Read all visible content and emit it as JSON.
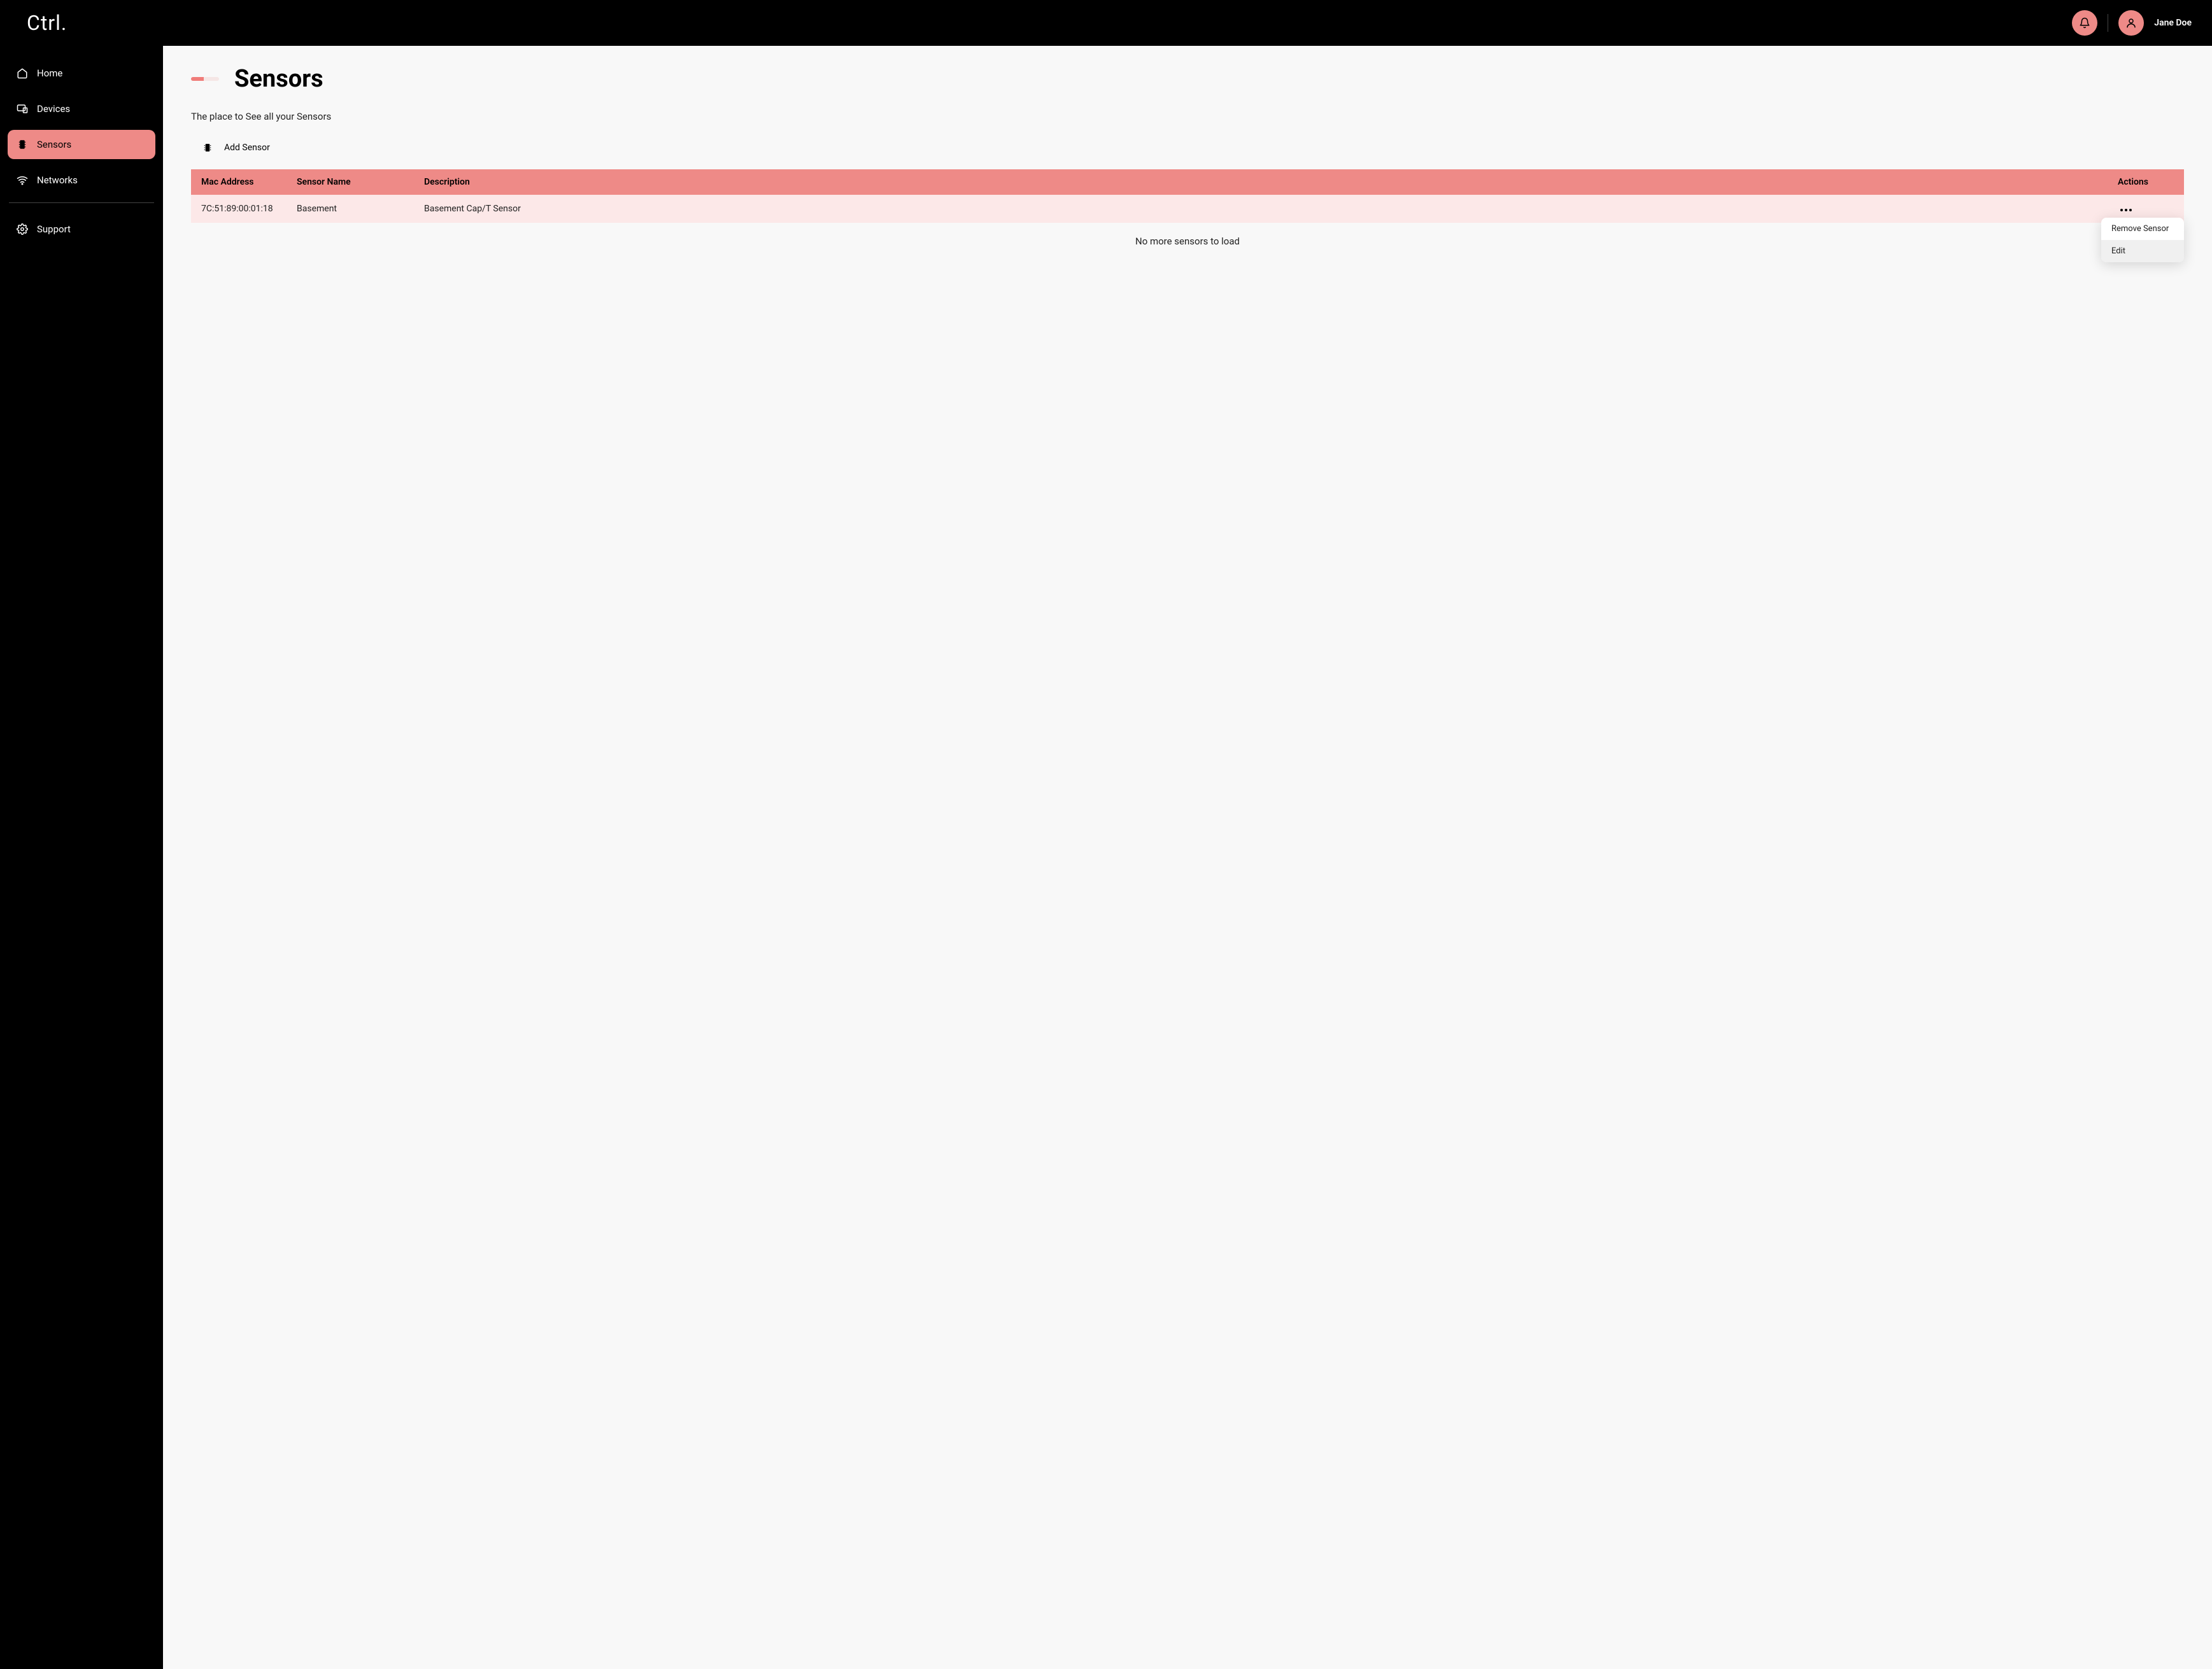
{
  "brand": "Ctrl.",
  "user": {
    "name": "Jane Doe"
  },
  "sidebar": {
    "items": [
      {
        "label": "Home"
      },
      {
        "label": "Devices"
      },
      {
        "label": "Sensors"
      },
      {
        "label": "Networks"
      },
      {
        "label": "Support"
      }
    ]
  },
  "page": {
    "title": "Sensors",
    "subtitle": "The place to See all your Sensors",
    "add_label": "Add Sensor",
    "no_more": "No more sensors to load"
  },
  "table": {
    "headers": {
      "mac": "Mac Address",
      "name": "Sensor Name",
      "description": "Description",
      "actions": "Actions"
    },
    "rows": [
      {
        "mac": "7C:51:89:00:01:18",
        "name": "Basement",
        "description": "Basement Cap/T Sensor"
      }
    ]
  },
  "dropdown": {
    "remove": "Remove Sensor",
    "edit": "Edit"
  }
}
